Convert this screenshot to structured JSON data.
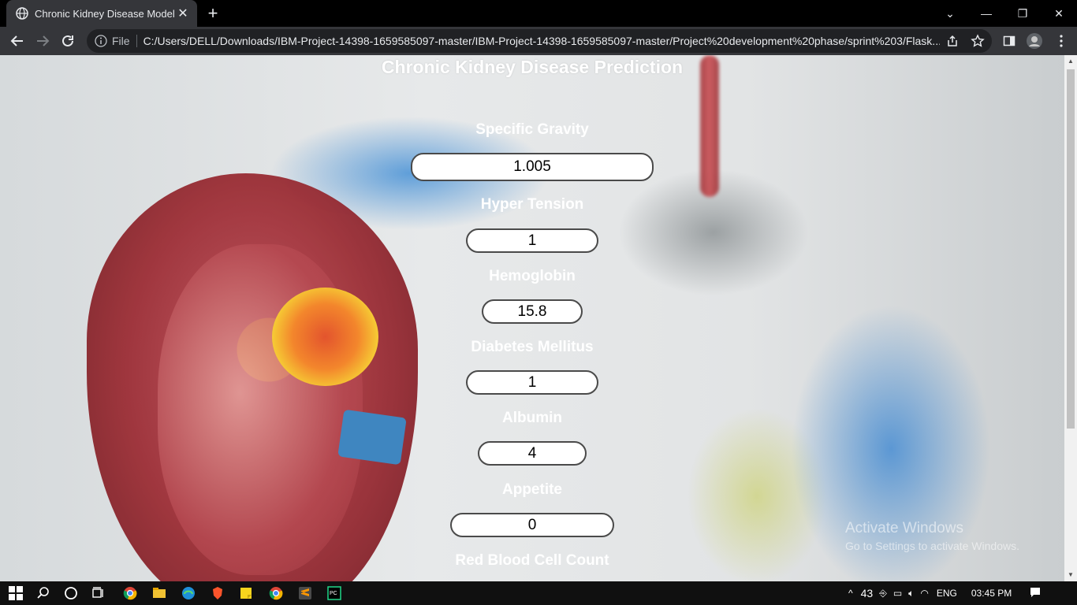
{
  "browser": {
    "tab_title": "Chronic Kidney Disease Model",
    "address_scheme": "File",
    "url": "C:/Users/DELL/Downloads/IBM-Project-14398-1659585097-master/IBM-Project-14398-1659585097-master/Project%20development%20phase/sprint%203/Flask..."
  },
  "page": {
    "title": "Chronic Kidney Disease Prediction",
    "fields": [
      {
        "label": "Specific Gravity",
        "value": "1.005"
      },
      {
        "label": "Hyper Tension",
        "value": "1"
      },
      {
        "label": "Hemoglobin",
        "value": "15.8"
      },
      {
        "label": "Diabetes Mellitus",
        "value": "1"
      },
      {
        "label": "Albumin",
        "value": "4"
      },
      {
        "label": "Appetite",
        "value": "0"
      },
      {
        "label": "Red Blood Cell Count",
        "value": ""
      }
    ]
  },
  "watermark": {
    "line1": "Activate Windows",
    "line2": "Go to Settings to activate Windows."
  },
  "taskbar": {
    "temperature": "43",
    "language": "ENG",
    "time": "03:45 PM"
  },
  "colors": {
    "chrome_tab": "#35363a",
    "omnibox": "#202124",
    "taskbar": "#101010",
    "input_border": "#4a4a4a"
  }
}
